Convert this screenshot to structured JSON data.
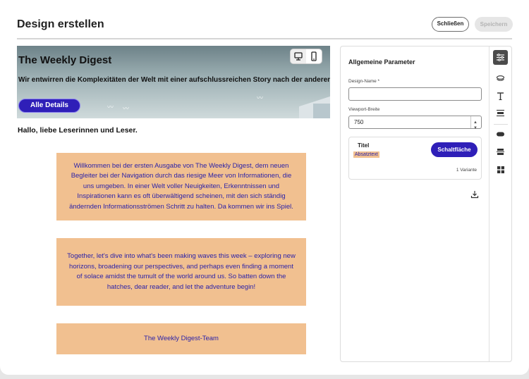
{
  "dialog": {
    "title": "Design erstellen",
    "close_label": "Schließen",
    "save_label": "Speichern"
  },
  "canvas": {
    "device_toggle": [
      "desktop-icon",
      "mobile-icon"
    ],
    "hero": {
      "title": "The Weekly Digest",
      "subtitle": "Wir entwirren die Komplexitäten der Welt mit einer aufschlussreichen Story nach der anderen.",
      "button_label": "Alle Details"
    },
    "greeting": "Hallo, liebe Leserinnen und Leser.",
    "paragraphs": [
      "Willkommen bei der ersten Ausgabe von The Weekly Digest, dem neuen Begleiter bei der Navigation durch das riesige Meer von Informationen, die uns umgeben. In einer Welt voller Neuigkeiten, Erkenntnissen und Inspirationen kann es oft überwältigend scheinen, mit den sich ständig ändernden Informationsströmen Schritt zu halten. Da kommen wir ins Spiel.",
      "Together, let's dive into what's been making waves this week – exploring new horizons, broadening our perspectives, and perhaps even finding a moment of solace amidst the tumult of the world around us. So batten down the hatches, dear reader, and let the adventure begin!",
      "The Weekly Digest-Team"
    ]
  },
  "panel": {
    "heading": "Allgemeine Parameter",
    "design_name_label": "Design-Name *",
    "design_name_value": "",
    "viewport_label": "Viewport-Breite",
    "viewport_value": "750",
    "preview": {
      "title": "Titel",
      "text": "Absatztext",
      "button": "Schaltfläche",
      "variant": "1 Variante"
    },
    "rail_icons": [
      "settings-icon",
      "layers-icon",
      "text-icon",
      "header-icon",
      "button-icon",
      "divider-icon",
      "grid-icon"
    ]
  },
  "colors": {
    "accent": "#2f1fb8",
    "block_bg": "#f1c090",
    "block_text": "#2c22a8"
  }
}
